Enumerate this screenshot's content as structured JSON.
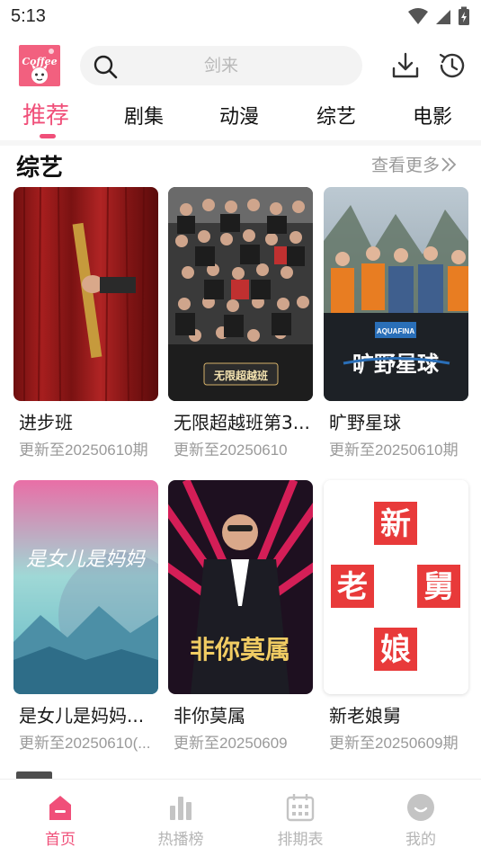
{
  "status_bar": {
    "time": "5:13"
  },
  "header": {
    "logo_text": "Coffee",
    "search_placeholder": "剑来",
    "download_icon": "download-icon",
    "history_icon": "history-icon"
  },
  "tabs": [
    {
      "label": "推荐",
      "active": true
    },
    {
      "label": "剧集",
      "active": false
    },
    {
      "label": "动漫",
      "active": false
    },
    {
      "label": "综艺",
      "active": false
    },
    {
      "label": "电影",
      "active": false
    }
  ],
  "section": {
    "title": "综艺",
    "see_more": "查看更多"
  },
  "cards": [
    {
      "title": "进步班",
      "subtitle": "更新至20250610期",
      "poster_text": ""
    },
    {
      "title": "无限超越班第3...",
      "subtitle": "更新至20250610",
      "poster_text": "无限超越班"
    },
    {
      "title": "旷野星球",
      "subtitle": "更新至20250610期",
      "poster_text": "旷野星球"
    },
    {
      "title": "是女儿是妈妈...",
      "subtitle": "更新至20250610(...",
      "poster_text": "是女儿是妈妈"
    },
    {
      "title": "非你莫属",
      "subtitle": "更新至20250609",
      "poster_text": "非你莫属"
    },
    {
      "title": "新老娘舅",
      "subtitle": "更新至20250609期",
      "poster_chars": [
        "新",
        "老",
        "舅",
        "娘"
      ]
    }
  ],
  "bottom_nav": [
    {
      "label": "首页",
      "icon": "home-icon",
      "active": true
    },
    {
      "label": "热播榜",
      "icon": "bar-chart-icon",
      "active": false
    },
    {
      "label": "排期表",
      "icon": "calendar-icon",
      "active": false
    },
    {
      "label": "我的",
      "icon": "profile-icon",
      "active": false
    }
  ],
  "colors": {
    "accent": "#f04f79",
    "muted": "#9a9a9a",
    "nav_inactive": "#b5b5b5"
  }
}
